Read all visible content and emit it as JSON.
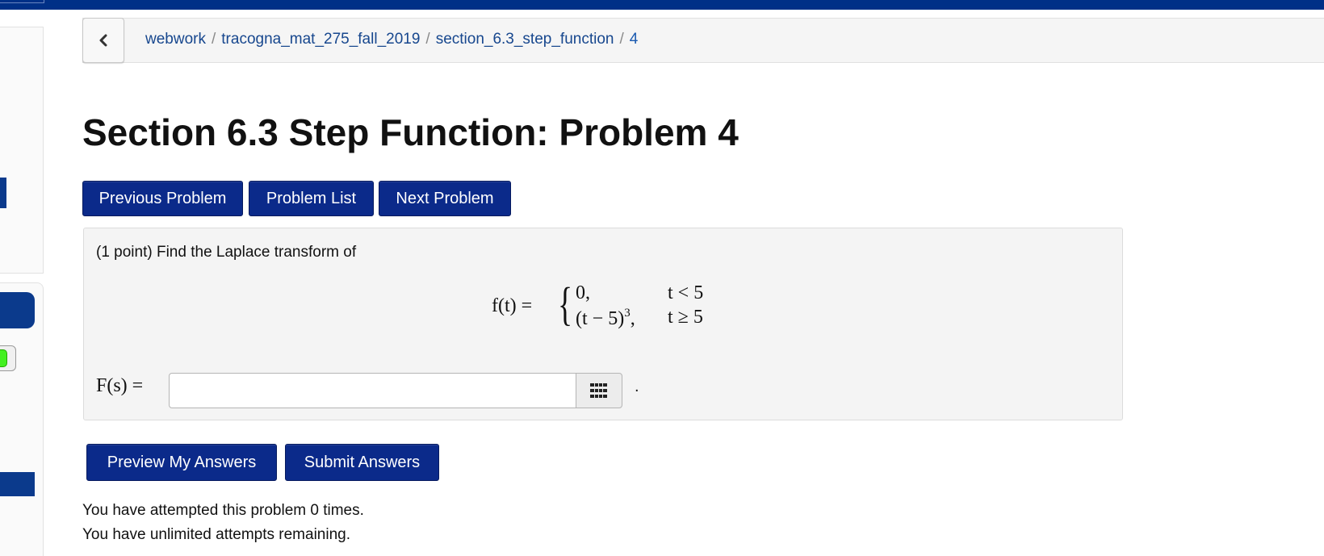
{
  "breadcrumb": {
    "items": [
      "webwork",
      "tracogna_mat_275_fall_2019",
      "section_6.3_step_function",
      "4"
    ],
    "separator": "/"
  },
  "page_title": "Section 6.3 Step Function: Problem 4",
  "nav_buttons": {
    "previous": "Previous Problem",
    "list": "Problem List",
    "next": "Next Problem"
  },
  "problem": {
    "statement": "(1 point) Find the Laplace transform of",
    "formula": {
      "lhs": "f(t) =",
      "case1_value": "0,",
      "case1_condition": "t < 5",
      "case2_value": "(t − 5)",
      "case2_exponent": "3",
      "case2_suffix": ",",
      "case2_condition": "t ≥ 5"
    },
    "answer_label": "F(s) =",
    "answer_value": "",
    "answer_suffix": "."
  },
  "action_buttons": {
    "preview": "Preview My Answers",
    "submit": "Submit Answers"
  },
  "attempts": {
    "line1": "You have attempted this problem 0 times.",
    "line2": "You have unlimited attempts remaining."
  },
  "colors": {
    "top_bar": "#003087",
    "button_bg": "#0b2a8a",
    "link": "#17478e",
    "panel_bg": "#f4f4f4"
  },
  "icons": {
    "back": "chevron-left-icon",
    "keyboard": "grid-keypad-icon"
  }
}
